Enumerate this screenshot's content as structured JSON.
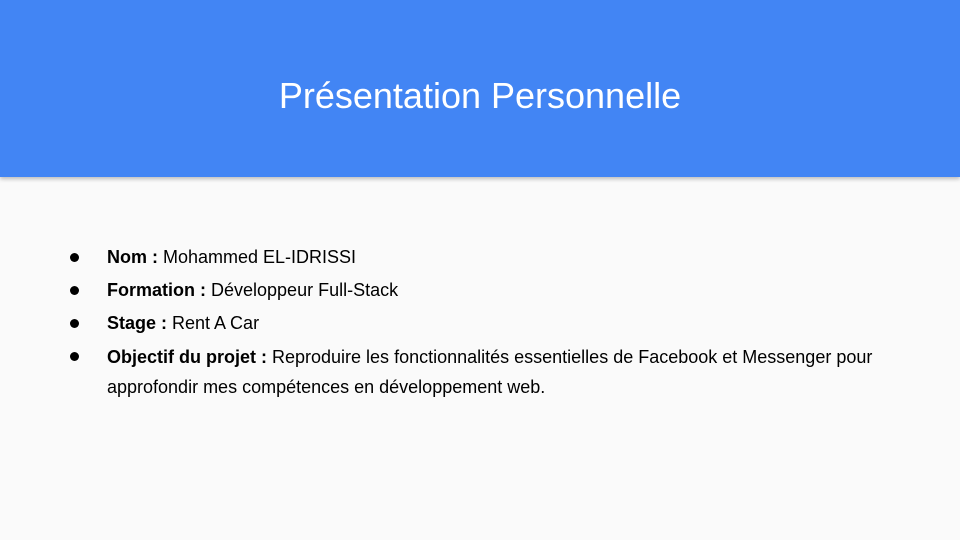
{
  "slide": {
    "title": "Présentation Personnelle",
    "header_color": "#4285f4",
    "background_color": "#fafafa",
    "bullets": [
      {
        "label": "Nom :",
        "text": "Mohammed EL-IDRISSI"
      },
      {
        "label": "Formation :",
        "text": "Développeur Full-Stack"
      },
      {
        "label": "Stage :",
        "text": "Rent A Car"
      },
      {
        "label": "Objectif du projet :",
        "text": "Reproduire les fonctionnalités essentielles de Facebook et Messenger pour approfondir mes compétences en développement web."
      }
    ]
  }
}
